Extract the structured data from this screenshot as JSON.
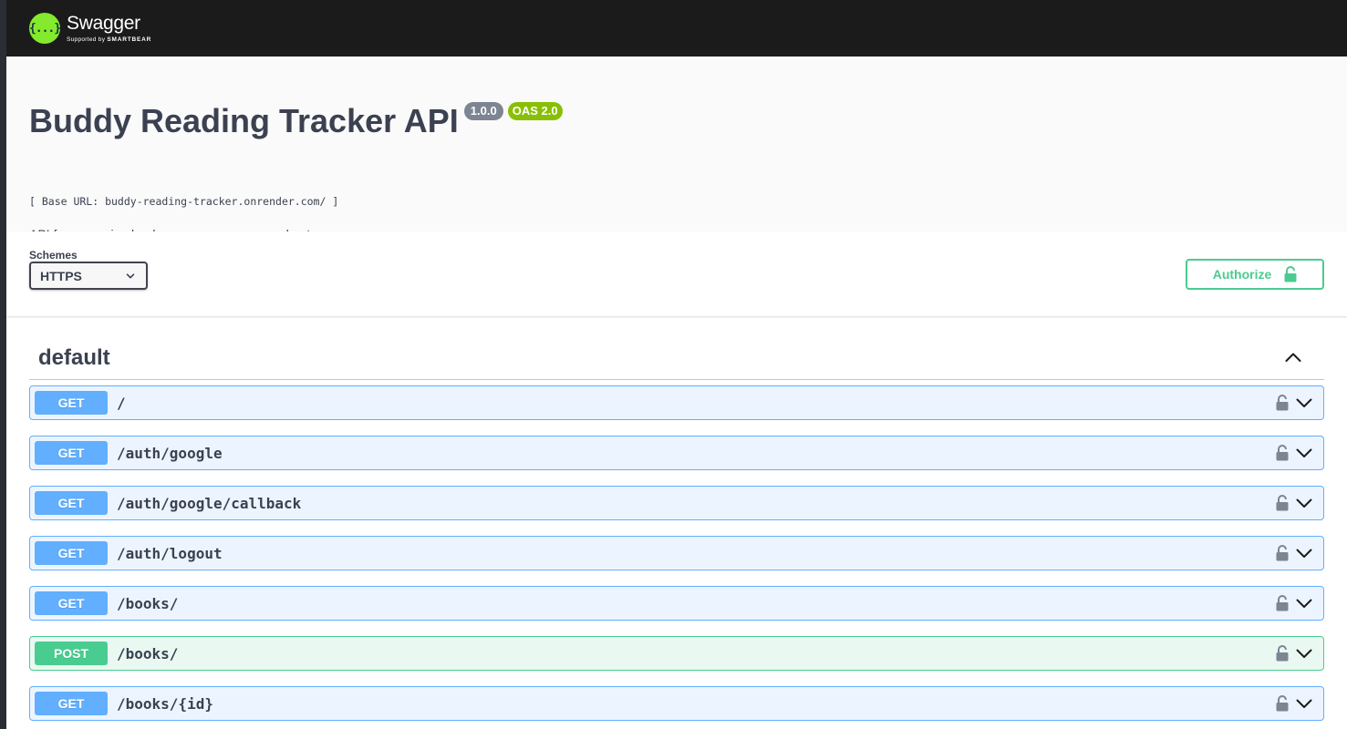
{
  "topbar": {
    "logo_mark": "{...}",
    "brand": "Swagger",
    "supported_by_prefix": "Supported by",
    "supported_by_brand": "SMARTBEAR"
  },
  "info": {
    "title": "Buddy Reading Tracker API",
    "version": "1.0.0",
    "oas_version": "OAS 2.0",
    "base_url": "[ Base URL: buddy-reading-tracker.onrender.com/ ]",
    "description": "API for managing books, users, progress, and notes"
  },
  "schemes": {
    "label": "Schemes",
    "selected": "HTTPS"
  },
  "authorize": {
    "label": "Authorize",
    "icon": "unlock-icon"
  },
  "tag": {
    "name": "default",
    "expanded": true
  },
  "operations": [
    {
      "method": "GET",
      "path": "/"
    },
    {
      "method": "GET",
      "path": "/auth/google"
    },
    {
      "method": "GET",
      "path": "/auth/google/callback"
    },
    {
      "method": "GET",
      "path": "/auth/logout"
    },
    {
      "method": "GET",
      "path": "/books/"
    },
    {
      "method": "POST",
      "path": "/books/"
    },
    {
      "method": "GET",
      "path": "/books/{id}"
    }
  ],
  "colors": {
    "get": "#61affe",
    "post": "#49cc90",
    "authorize": "#49cc90",
    "logo": "#85ea2d",
    "oas_badge": "#89bf04",
    "version_badge": "#7d8492"
  }
}
